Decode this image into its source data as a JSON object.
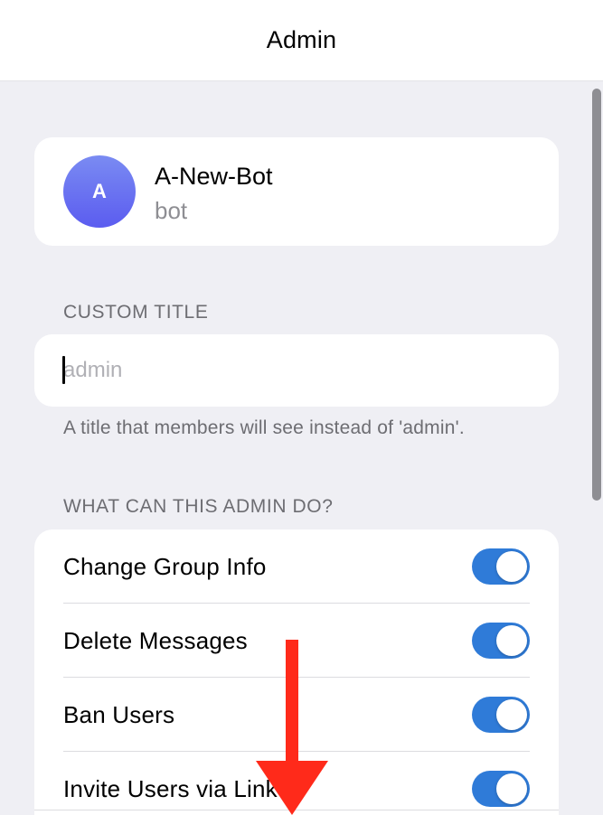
{
  "nav": {
    "title": "Admin"
  },
  "profile": {
    "avatar_letter": "A",
    "name": "A-New-Bot",
    "subtitle": "bot"
  },
  "custom_title": {
    "header": "CUSTOM TITLE",
    "placeholder": "admin",
    "value": "",
    "footer": "A title that members will see instead of 'admin'."
  },
  "permissions": {
    "header": "WHAT CAN THIS ADMIN DO?",
    "items": [
      {
        "label": "Change Group Info",
        "enabled": true
      },
      {
        "label": "Delete Messages",
        "enabled": true
      },
      {
        "label": "Ban Users",
        "enabled": true
      },
      {
        "label": "Invite Users via Link",
        "enabled": true
      }
    ]
  },
  "colors": {
    "accent": "#2f7bd8",
    "annotation_arrow": "#ff2a1a",
    "avatar_gradient_top": "#7a8bf2",
    "avatar_gradient_bottom": "#5b5cf0"
  },
  "icons": {
    "annotation": "down-arrow-icon"
  }
}
